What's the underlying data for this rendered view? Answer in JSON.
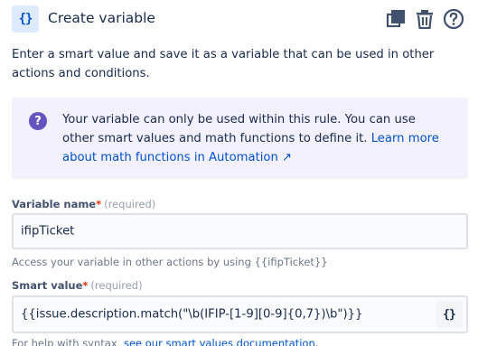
{
  "header": {
    "icon_glyph": "{}",
    "title": "Create variable",
    "actions": [
      "copy-icon",
      "trash-icon",
      "help-icon"
    ]
  },
  "description": "Enter a smart value and save it as a variable that can be used in other actions and conditions.",
  "info": {
    "icon": "question-icon",
    "text": "Your variable can only be used within this rule. You can use other smart values and math functions to define it. ",
    "link": "Learn more about math functions in Automation ↗"
  },
  "variable_name": {
    "label": "Variable name",
    "required_star": "*",
    "required_text": "(required)",
    "value": "ifipTicket",
    "helper": "Access your variable in other actions by using {{ifipTicket}}"
  },
  "smart_value": {
    "label": "Smart value",
    "required_star": "*",
    "required_text": "(required)",
    "value": "{{issue.description.match(\"\\b(IFIP-[1-9][0-9]{0,7})\\b\")}}",
    "button_glyph": "{}",
    "helper_prefix": "For help with syntax, ",
    "helper_link": "see our smart values documentation."
  },
  "colors": {
    "accent": "#0052cc",
    "info_bg": "#f3f0ff",
    "info_icon": "#6554c0",
    "required": "#de350b"
  }
}
